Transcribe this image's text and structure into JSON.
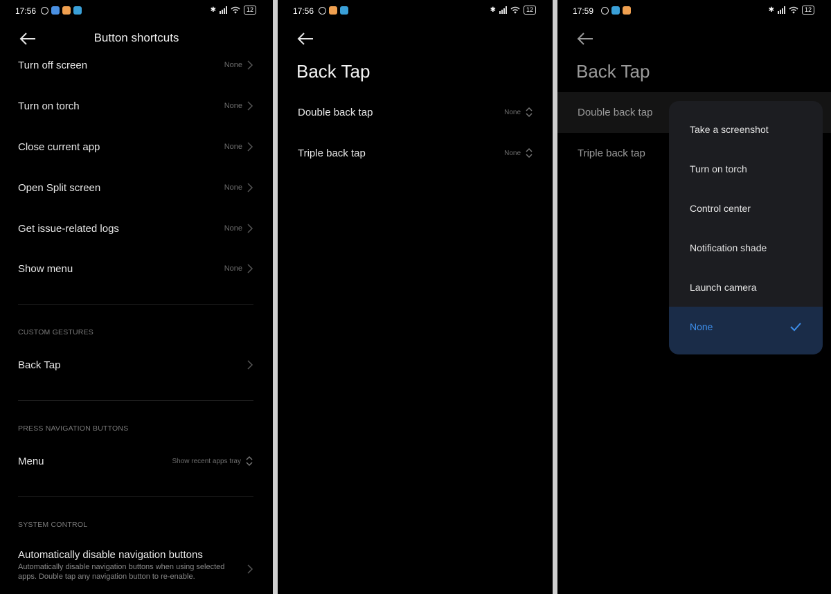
{
  "screen1": {
    "status": {
      "time": "17:56",
      "battery": "12"
    },
    "header_title": "Button shortcuts",
    "rows": [
      {
        "label": "Turn off screen",
        "value": "None"
      },
      {
        "label": "Turn on torch",
        "value": "None"
      },
      {
        "label": "Close current app",
        "value": "None"
      },
      {
        "label": "Open Split screen",
        "value": "None"
      },
      {
        "label": "Get issue-related logs",
        "value": "None"
      },
      {
        "label": "Show menu",
        "value": "None"
      }
    ],
    "custom_gestures": {
      "section": "CUSTOM GESTURES",
      "back_tap": "Back Tap"
    },
    "press_nav": {
      "section": "PRESS NAVIGATION BUTTONS",
      "menu_label": "Menu",
      "menu_value": "Show recent apps tray"
    },
    "system_control": {
      "section": "SYSTEM CONTROL",
      "title": "Automatically disable navigation buttons",
      "desc": "Automatically disable navigation buttons when using selected apps. Double tap any navigation button to re-enable."
    }
  },
  "screen2": {
    "status": {
      "time": "17:56",
      "battery": "12"
    },
    "title": "Back Tap",
    "rows": [
      {
        "label": "Double back tap",
        "value": "None"
      },
      {
        "label": "Triple back tap",
        "value": "None"
      }
    ]
  },
  "screen3": {
    "status": {
      "time": "17:59",
      "battery": "12"
    },
    "title": "Back Tap",
    "rows": [
      {
        "label": "Double back tap"
      },
      {
        "label": "Triple back tap"
      }
    ],
    "options": [
      "Take a screenshot",
      "Turn on torch",
      "Control center",
      "Notification shade",
      "Launch camera",
      "None"
    ],
    "selected_option": "None"
  },
  "colors": {
    "accent": "#3d8eea",
    "background": "#000000",
    "popup": "#1c1d21"
  }
}
